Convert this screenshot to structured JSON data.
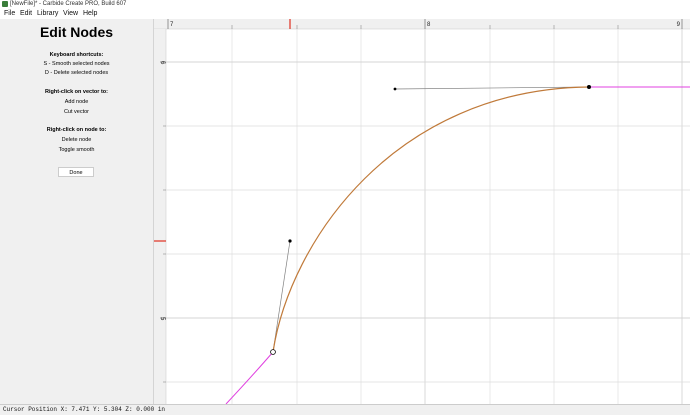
{
  "window": {
    "title": "[NewFile]* - Carbide Create PRO, Build 607"
  },
  "menu": {
    "file": "File",
    "edit": "Edit",
    "library": "Library",
    "view": "View",
    "help": "Help"
  },
  "panel": {
    "heading": "Edit Nodes",
    "shortcuts_title": "Keyboard shortcuts:",
    "shortcut_smooth": "S - Smooth selected nodes",
    "shortcut_delete": "D - Delete selected nodes",
    "vector_title": "Right-click on vector to:",
    "vector_add": "Add node",
    "vector_cut": "Cut vector",
    "node_title": "Right-click on node to:",
    "node_delete": "Delete node",
    "node_toggle": "Toggle smooth",
    "done": "Done"
  },
  "ruler": {
    "top_labels": [
      "7",
      "8",
      "9"
    ],
    "left_labels": [
      "6",
      "5"
    ]
  },
  "colors": {
    "curve": "#c07a3a",
    "handle": "#808080",
    "continuation": "#e040e0",
    "marker": "#e03020",
    "grid": "#dedede"
  },
  "status": {
    "text": "Cursor Position X: 7.471 Y: 5.304 Z: 0.000 in"
  }
}
